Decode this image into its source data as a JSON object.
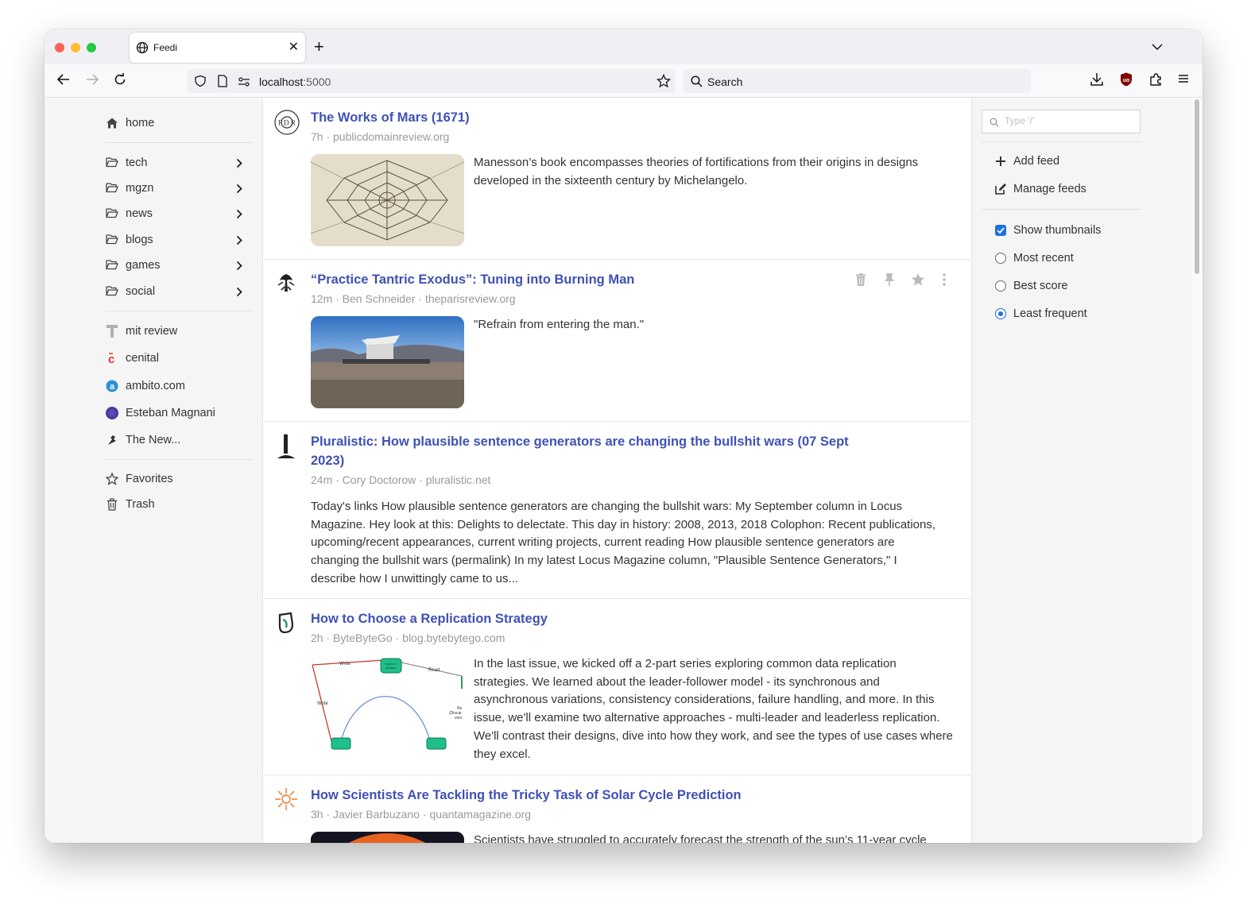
{
  "browser": {
    "tab_title": "Feedi",
    "url_host": "localhost",
    "url_port": ":5000",
    "search_placeholder": "Search"
  },
  "sidebar": {
    "home": "home",
    "folders": [
      "tech",
      "mgzn",
      "news",
      "blogs",
      "games",
      "social"
    ],
    "feeds": [
      "mit review",
      "cenital",
      "ambito.com",
      "Esteban Magnani",
      "The New..."
    ],
    "favorites": "Favorites",
    "trash": "Trash"
  },
  "entries": [
    {
      "title": "The Works of Mars (1671)",
      "meta": "7h · publicdomainreview.org",
      "body": "Manesson’s book encompasses theories of fortifications from their origins in designs developed in the sixteenth century by Michelangelo.",
      "icon": "pdr-logo-icon"
    },
    {
      "title": "“Practice Tantric Exodus”: Tuning into Burning Man",
      "meta": "12m · Ben Schneider · theparisreview.org",
      "body": "\"Refrain from entering the man.\"",
      "icon": "paris-review-logo-icon"
    },
    {
      "title": "Pluralistic: How plausible sentence generators are changing the bullshit wars (07 Sept 2023)",
      "meta": "24m · Cory Doctorow · pluralistic.net",
      "body": "Today's links How plausible sentence generators are changing the bullshit wars: My September column in Locus Magazine. Hey look at this: Delights to delectate. This day in history: 2008, 2013, 2018 Colophon: Recent publications, upcoming/recent appearances, current writing projects, current reading How plausible sentence generators are changing the bullshit wars (permalink) In my latest Locus Magazine column, \"Plausible Sentence Generators,\" I describe how I unwittingly came to us...",
      "icon": "pluralistic-logo-icon"
    },
    {
      "title": "How to Choose a Replication Strategy",
      "meta": "2h · ByteByteGo · blog.bytebytego.com",
      "body": "In the last issue, we kicked off a 2-part series exploring common data replication strategies. We learned about the leader-follower model - its synchronous and asynchronous variations, consistency considerations, failure handling, and more. In this issue, we'll examine two alternative approaches - multi-leader and leaderless replication. We'll contrast their designs, dive into how they work, and see the types of use cases where they excel.",
      "icon": "bytebytego-logo-icon",
      "diagram_labels": [
        "Write",
        "Read",
        "Write",
        "Re",
        "(Discar",
        "vers",
        "replica 1",
        "(leader)"
      ]
    },
    {
      "title": "How Scientists Are Tackling the Tricky Task of Solar Cycle Prediction",
      "meta": "3h · Javier Barbuzano · quantamagazine.org",
      "body": "Scientists have struggled to accurately forecast the strength of the sun’s 11-year cycle",
      "icon": "quanta-logo-icon"
    }
  ],
  "right_panel": {
    "search_placeholder": "Type '/'",
    "add_feed": "Add feed",
    "manage_feeds": "Manage feeds",
    "show_thumbnails": "Show thumbnails",
    "show_thumbnails_checked": true,
    "sort_options": [
      "Most recent",
      "Best score",
      "Least frequent"
    ],
    "sort_selected": "Least frequent"
  },
  "colors": {
    "title_link": "#3f51b5",
    "accent": "#1e6fe0",
    "meta": "#999999"
  }
}
